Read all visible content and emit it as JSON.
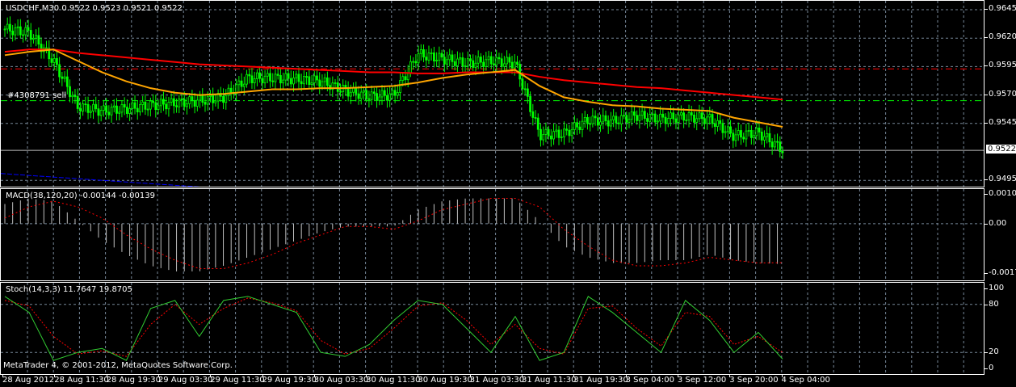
{
  "header": {
    "symbol_info": "USDCHF,M30  0.9522 0.9523 0.9521 0.9522"
  },
  "order_label": "#4308791 sell",
  "current_price": "0.9522",
  "copyright": "MetaTrader 4, © 2001-2012, MetaQuotes Software Corp.",
  "colors": {
    "bg": "#000000",
    "candle": "#00ff00",
    "ma_fast": "#ffa500",
    "ma_slow": "#ff0000",
    "grid": "#778899",
    "blue_line": "#0000ff",
    "macd_hist": "#c0c0c0",
    "macd_signal": "#ff0000",
    "stoch_main": "#32cd32",
    "stoch_signal": "#ff0000"
  },
  "chart_data": [
    {
      "type": "line",
      "title": "USDCHF,M30",
      "ylim": [
        0.9485,
        0.9652
      ],
      "yticks": [
        "0.9645",
        "0.9620",
        "0.9595",
        "0.9570",
        "0.9545",
        "0.9495"
      ],
      "x_labels": [
        "28 Aug 2012",
        "28 Aug 11:30",
        "28 Aug 19:30",
        "29 Aug 03:30",
        "29 Aug 11:30",
        "29 Aug 19:30",
        "30 Aug 03:30",
        "30 Aug 11:30",
        "30 Aug 19:30",
        "31 Aug 03:30",
        "31 Aug 11:30",
        "31 Aug 19:30",
        "3 Sep 04:00",
        "3 Sep 12:00",
        "3 Sep 20:00",
        "4 Sep 04:00"
      ],
      "close": [
        0.9628,
        0.9625,
        0.96,
        0.956,
        0.9556,
        0.9558,
        0.9561,
        0.9563,
        0.9565,
        0.9568,
        0.9585,
        0.9585,
        0.9584,
        0.9582,
        0.9574,
        0.9569,
        0.957,
        0.9606,
        0.9602,
        0.9598,
        0.96,
        0.9598,
        0.9535,
        0.9536,
        0.9548,
        0.9547,
        0.9552,
        0.9549,
        0.9551,
        0.9549,
        0.9534,
        0.9537,
        0.9522
      ],
      "ma_fast": [
        0.9605,
        0.9608,
        0.961,
        0.96,
        0.959,
        0.9582,
        0.9576,
        0.9572,
        0.957,
        0.9571,
        0.9573,
        0.9575,
        0.9575,
        0.9576,
        0.9576,
        0.9577,
        0.9578,
        0.9581,
        0.9585,
        0.9588,
        0.959,
        0.9592,
        0.9578,
        0.9568,
        0.9564,
        0.9561,
        0.956,
        0.9558,
        0.9557,
        0.9556,
        0.955,
        0.9546,
        0.9542
      ],
      "ma_slow": [
        0.9608,
        0.961,
        0.961,
        0.9607,
        0.9605,
        0.9603,
        0.9601,
        0.9599,
        0.9597,
        0.9596,
        0.9595,
        0.9594,
        0.9593,
        0.9592,
        0.9591,
        0.959,
        0.959,
        0.9589,
        0.9589,
        0.959,
        0.959,
        0.959,
        0.9586,
        0.9583,
        0.9581,
        0.9579,
        0.9577,
        0.9576,
        0.9574,
        0.9572,
        0.957,
        0.9568,
        0.9566
      ],
      "blue_line": [
        0.9501,
        0.9489
      ],
      "order_line": 0.9565,
      "red_level_line": 0.9593
    },
    {
      "type": "bar",
      "title": "MACD(38,120,20) -0.00144 -0.00139",
      "ylim": [
        -0.00176,
        0.00106
      ],
      "yticks": [
        "0.00106",
        "0.00",
        "-0.00176"
      ],
      "histogram": [
        0.0007,
        0.0009,
        0.0008,
        0.0001,
        -0.0006,
        -0.0011,
        -0.0015,
        -0.0017,
        -0.0017,
        -0.0015,
        -0.0012,
        -0.0009,
        -0.0006,
        -0.0003,
        -0.0001,
        -0.0001,
        -0.0001,
        0.0005,
        0.0008,
        0.0009,
        0.0009,
        0.0009,
        0.0001,
        -0.0008,
        -0.0012,
        -0.0014,
        -0.0014,
        -0.0013,
        -0.0013,
        -0.0011,
        -0.0013,
        -0.0014,
        -0.00144
      ],
      "signal": [
        0.0002,
        0.0006,
        0.0008,
        0.0006,
        0.0002,
        -0.0004,
        -0.0009,
        -0.0013,
        -0.0016,
        -0.0016,
        -0.0014,
        -0.0011,
        -0.0007,
        -0.0004,
        -0.0001,
        -0.0001,
        -0.0002,
        0.0001,
        0.0005,
        0.0007,
        0.0009,
        0.0009,
        0.0006,
        -0.0002,
        -0.0008,
        -0.0013,
        -0.0015,
        -0.0015,
        -0.0014,
        -0.0012,
        -0.0013,
        -0.0014,
        -0.00139
      ]
    },
    {
      "type": "line",
      "title": "Stoch(14,3,3) 11.7647 19.8705",
      "ylim": [
        0,
        100
      ],
      "yticks": [
        "100",
        "80",
        "20",
        "0"
      ],
      "main": [
        90,
        70,
        10,
        20,
        25,
        10,
        75,
        85,
        40,
        85,
        90,
        80,
        70,
        20,
        15,
        30,
        60,
        85,
        80,
        50,
        20,
        65,
        10,
        20,
        90,
        70,
        45,
        20,
        85,
        60,
        20,
        45,
        11.76
      ],
      "signal": [
        85,
        78,
        40,
        18,
        22,
        15,
        55,
        80,
        55,
        75,
        88,
        82,
        72,
        35,
        18,
        25,
        50,
        78,
        82,
        60,
        30,
        55,
        25,
        18,
        75,
        78,
        50,
        28,
        70,
        65,
        30,
        40,
        19.87
      ]
    }
  ]
}
